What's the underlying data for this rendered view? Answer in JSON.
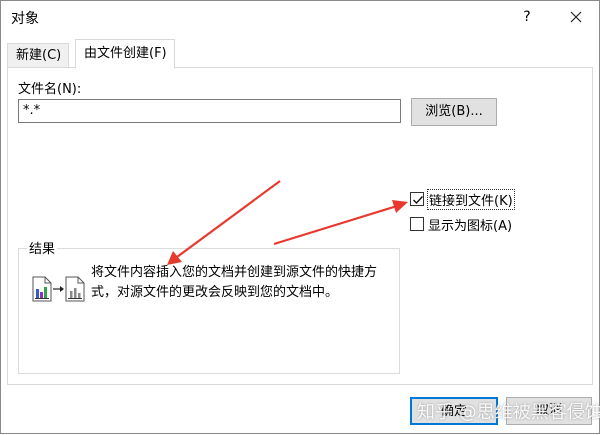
{
  "window": {
    "title": "对象",
    "help": "?"
  },
  "tabs": [
    {
      "label": "新建(C)"
    },
    {
      "label": "由文件创建(F)",
      "active": true
    }
  ],
  "form": {
    "filename_label": "文件名(N):",
    "filename_value": "*.*",
    "browse_label": "浏览(B)..."
  },
  "options": {
    "link_label": "链接到文件(K)",
    "link_checked": true,
    "icon_label": "显示为图标(A)",
    "icon_checked": false
  },
  "result": {
    "label": "结果",
    "line1": "将文件内容插入您的文档并创建到源文件的快捷方",
    "line2": "式，对源文件的更改会反映到您的文档中。"
  },
  "buttons": {
    "ok_label": "确定",
    "cancel_label": "取消"
  },
  "watermark": "知乎 @思维被黑客侵蚀",
  "colors": {
    "annotation_arrow": "#e8392f",
    "default_button_border": "#0078d7"
  }
}
